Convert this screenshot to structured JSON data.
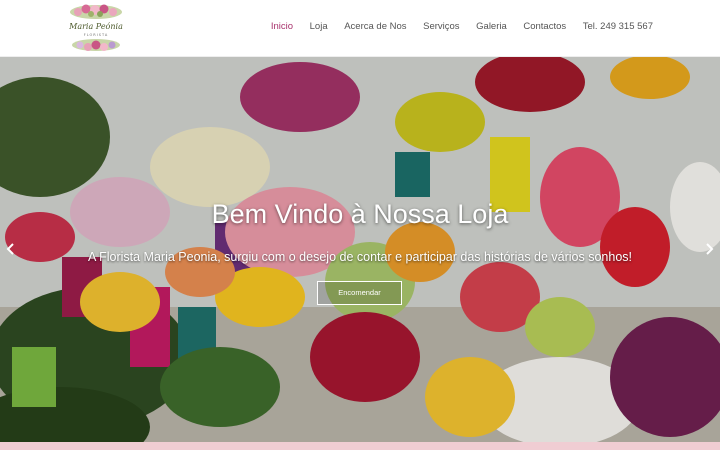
{
  "brand": {
    "logo_name": "Maria Peónia",
    "logo_tagline": "FLORISTA"
  },
  "nav": {
    "items": [
      {
        "label": "Inicio",
        "active": true
      },
      {
        "label": "Loja",
        "active": false
      },
      {
        "label": "Acerca de Nos",
        "active": false
      },
      {
        "label": "Serviços",
        "active": false
      },
      {
        "label": "Galeria",
        "active": false
      },
      {
        "label": "Contactos",
        "active": false
      },
      {
        "label": "Tel. 249 315 567",
        "active": false
      }
    ]
  },
  "hero": {
    "title": "Bem Vindo à Nossa Loja",
    "subtitle": "A Florista Maria Peonia, surgiu com o desejo de contar e participar das histórias de vários sonhos!",
    "button_label": "Encomendar"
  },
  "icons": {
    "prev": "chevron-left-icon",
    "next": "chevron-right-icon"
  },
  "colors": {
    "accent": "#a8336d",
    "nav_text": "#555555",
    "footer_strip": "#f0cdd3"
  }
}
